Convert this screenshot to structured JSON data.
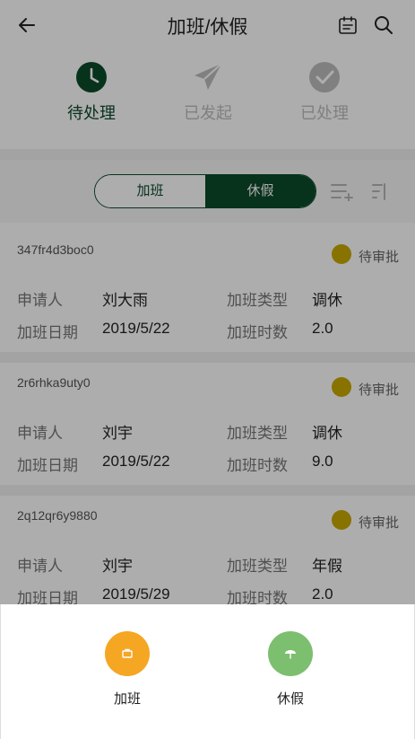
{
  "header": {
    "title": "加班/休假"
  },
  "status_tabs": [
    {
      "label": "待处理",
      "icon": "clock-icon",
      "active": true
    },
    {
      "label": "已发起",
      "icon": "paper-plane-icon",
      "active": false
    },
    {
      "label": "已处理",
      "icon": "check-circle-icon",
      "active": false
    }
  ],
  "segment": {
    "options": [
      "加班",
      "休假"
    ],
    "selected": "休假"
  },
  "records": [
    {
      "id": "347fr4d3boc0",
      "status": "待审批",
      "applicant_label": "申请人",
      "applicant": "刘大雨",
      "type_label": "加班类型",
      "type": "调休",
      "date_label": "加班日期",
      "date": "2019/5/22",
      "hours_label": "加班时数",
      "hours": "2.0"
    },
    {
      "id": "2r6rhka9uty0",
      "status": "待审批",
      "applicant_label": "申请人",
      "applicant": "刘宇",
      "type_label": "加班类型",
      "type": "调休",
      "date_label": "加班日期",
      "date": "2019/5/22",
      "hours_label": "加班时数",
      "hours": "9.0"
    },
    {
      "id": "2q12qr6y9880",
      "status": "待审批",
      "applicant_label": "申请人",
      "applicant": "刘宇",
      "type_label": "加班类型",
      "type": "年假",
      "date_label": "加班日期",
      "date": "2019/5/29",
      "hours_label": "加班时数",
      "hours": "2.0"
    }
  ],
  "sheet": {
    "actions": [
      {
        "label": "加班",
        "color": "#f5a623",
        "icon": "briefcase-icon"
      },
      {
        "label": "休假",
        "color": "#7cbf6e",
        "icon": "umbrella-icon"
      }
    ]
  },
  "colors": {
    "accent": "#0b4a2a",
    "pending": "#c9a800",
    "overtime_action": "#f5a623",
    "leave_action": "#7cbf6e"
  }
}
